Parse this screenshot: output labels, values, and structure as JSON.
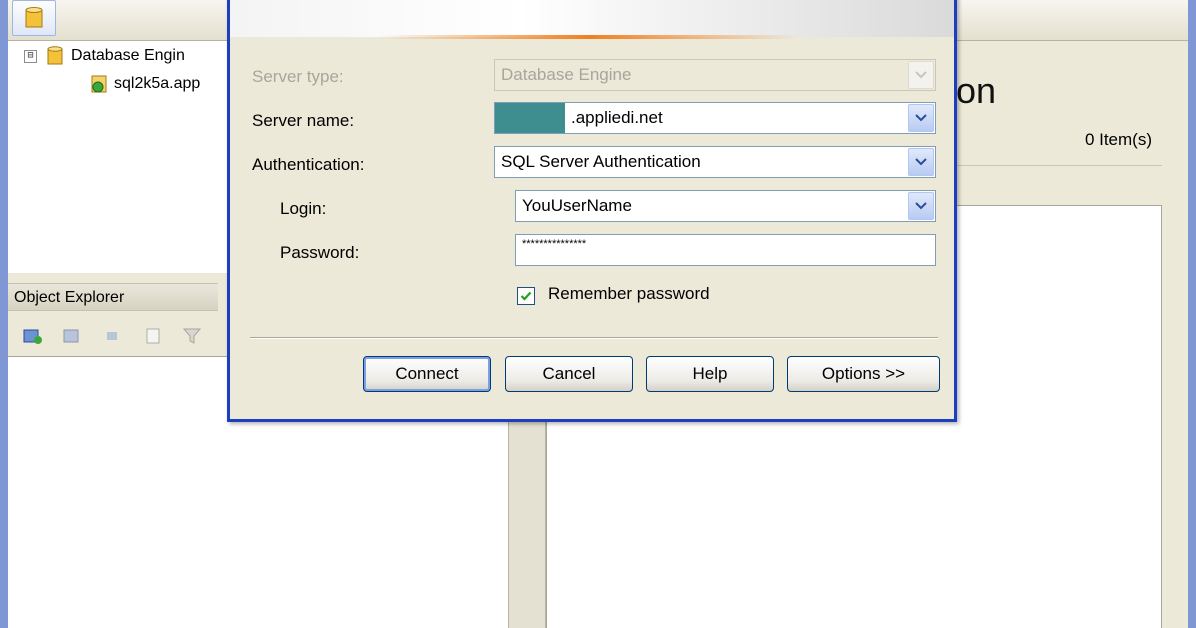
{
  "tree": {
    "root_label": "Database Engin",
    "root_expander": "⊟",
    "server_label": "sql2k5a.app"
  },
  "object_explorer": {
    "title": "Object Explorer"
  },
  "right_panel": {
    "title_fragment": "on",
    "items_count": "0 Item(s)"
  },
  "dialog": {
    "server_type": {
      "label": "Server type:",
      "value": "Database Engine"
    },
    "server_name": {
      "label": "Server name:",
      "value": ".appliedi.net"
    },
    "authentication": {
      "label": "Authentication:",
      "value": "SQL Server Authentication"
    },
    "login": {
      "label": "Login:",
      "value": "YouUserName"
    },
    "password": {
      "label": "Password:",
      "value": "***************"
    },
    "remember_password": {
      "label": "Remember password",
      "checked": true
    },
    "buttons": {
      "connect": "Connect",
      "cancel": "Cancel",
      "help": "Help",
      "options": "Options >>"
    }
  },
  "colors": {
    "dialog_border": "#1c3fbf",
    "accent": "#f08020",
    "redaction": "#3e8d8f"
  }
}
